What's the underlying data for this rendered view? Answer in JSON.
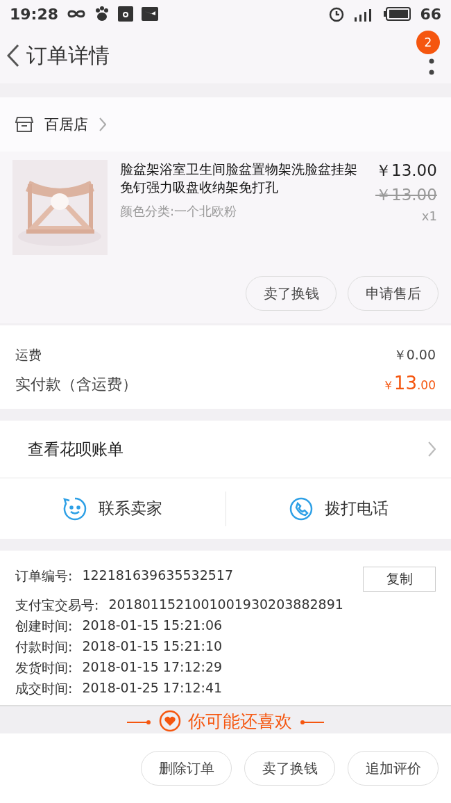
{
  "status_bar": {
    "time": "19:28",
    "battery": "66"
  },
  "header": {
    "title": "订单详情",
    "badge": "2"
  },
  "store": {
    "name": "百居店"
  },
  "product": {
    "title": "脸盆架浴室卫生间脸盆置物架洗脸盆挂架免钉强力吸盘收纳架免打孔",
    "variant": "颜色分类:一个北欧粉",
    "price": "￥13.00",
    "original_price": "￥13.00",
    "quantity": "x1",
    "actions": [
      "卖了换钱",
      "申请售后"
    ]
  },
  "fees": {
    "shipping_label": "运费",
    "shipping_value": "￥0.00",
    "paid_label": "实付款（含运费）",
    "paid_currency": "￥",
    "paid_int": "13",
    "paid_dec": ".00"
  },
  "huabei": {
    "label": "查看花呗账单"
  },
  "contact": [
    {
      "kind": "chat",
      "label": "联系卖家"
    },
    {
      "kind": "phone",
      "label": "拨打电话"
    }
  ],
  "order_info": {
    "copy_button": "复制",
    "rows": [
      {
        "label": "订单编号:",
        "value": "122181639635532517"
      },
      {
        "label": "支付宝交易号:",
        "value": "2018011521001001930203882891"
      },
      {
        "label": "创建时间:",
        "value": "2018-01-15 15:21:06"
      },
      {
        "label": "付款时间:",
        "value": "2018-01-15 15:21:10"
      },
      {
        "label": "发货时间:",
        "value": "2018-01-15 17:12:29"
      },
      {
        "label": "成交时间:",
        "value": "2018-01-25 17:12:41"
      }
    ]
  },
  "recommend": {
    "title": "你可能还喜欢"
  },
  "bottom_actions": [
    "删除订单",
    "卖了换钱",
    "追加评价"
  ]
}
